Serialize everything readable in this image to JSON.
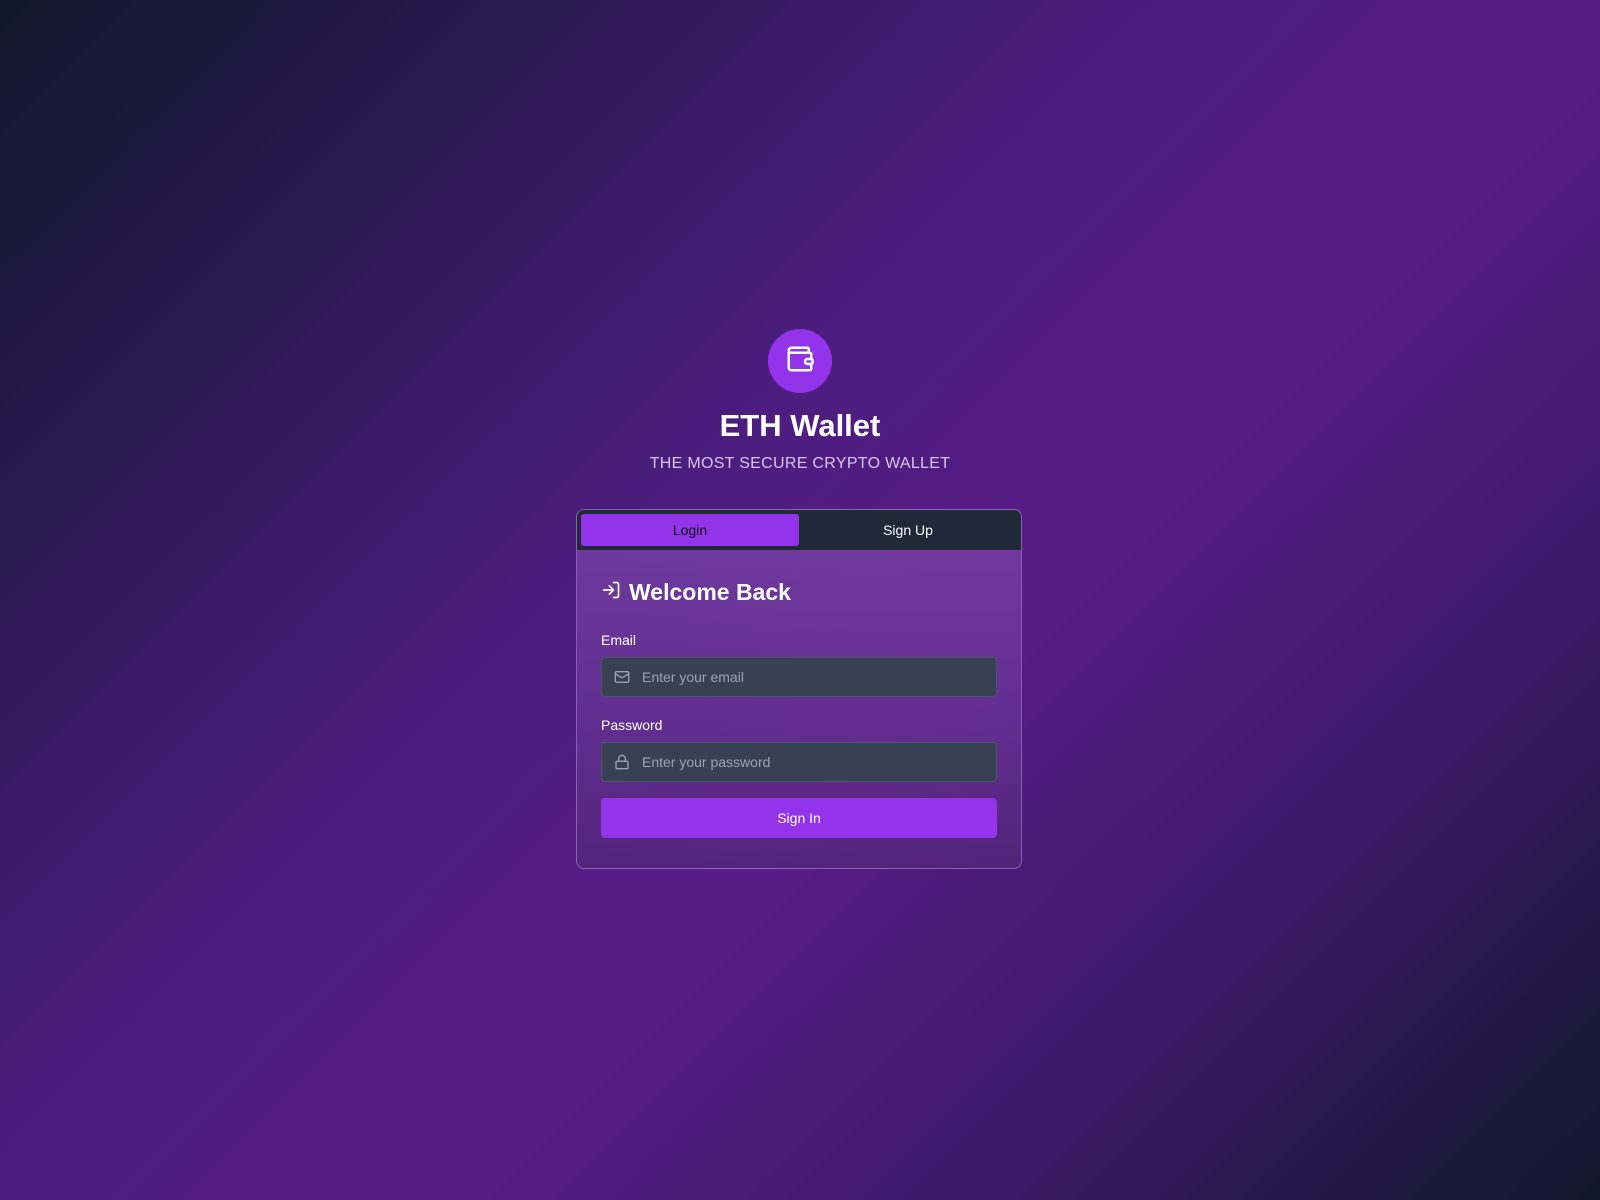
{
  "brand": {
    "icon": "wallet-icon",
    "title": "ETH Wallet",
    "subtitle": "THE MOST SECURE CRYPTO WALLET",
    "accent_color": "#9333ea"
  },
  "tabs": [
    {
      "label": "Login",
      "active": true
    },
    {
      "label": "Sign Up",
      "active": false
    }
  ],
  "form": {
    "heading_icon": "log-in-icon",
    "heading": "Welcome Back",
    "email": {
      "label": "Email",
      "icon": "mail-icon",
      "value": "",
      "placeholder": "Enter your email"
    },
    "password": {
      "label": "Password",
      "icon": "lock-icon",
      "value": "",
      "placeholder": "Enter your password"
    },
    "submit_label": "Sign In"
  }
}
